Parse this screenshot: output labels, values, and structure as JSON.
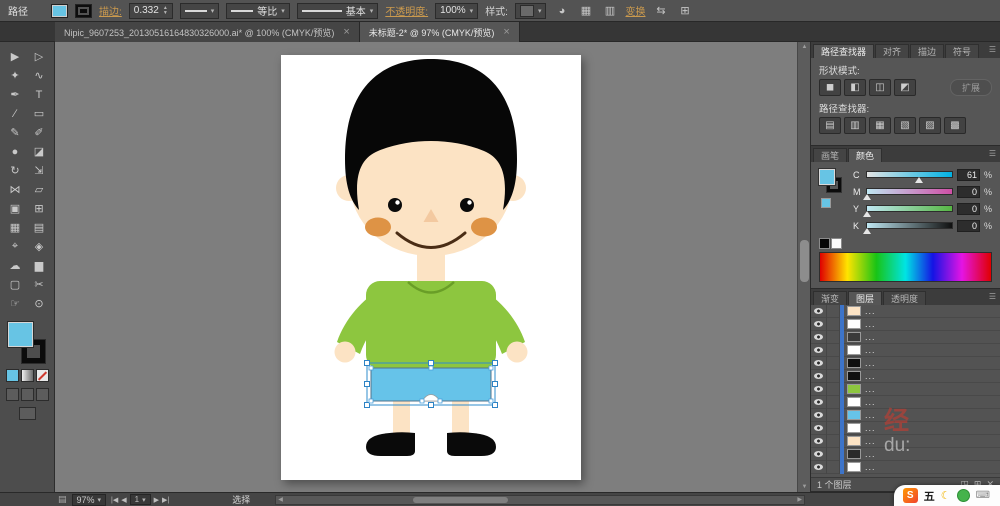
{
  "glyphs": {
    "caret": "▾",
    "up": "▲",
    "down": "▼",
    "left": "◀",
    "right": "▶",
    "first": "|◀",
    "last": "▶|",
    "menu": "☰",
    "grid": "▤"
  },
  "artwork": {
    "skin": "#fce3c4",
    "hair": "#070707",
    "sweater": "#8dc63f",
    "shorts": "#66c3e9",
    "cheek": "#de9345",
    "shoes": "#0a0a0a",
    "selection": "#2f8ccc"
  },
  "options_bar": {
    "context_label": "路径",
    "stroke_label": "描边:",
    "stroke_value": "0.332",
    "profile_value": "等比",
    "brush_value": "基本",
    "opacity_label": "不透明度:",
    "opacity_value": "100%",
    "style_label": "样式:",
    "transform_link": "变换",
    "icons": {
      "recolor": "◕",
      "align_a": "▦",
      "align_b": "▥",
      "arrange_a": "⇆",
      "arrange_b": "⊞"
    }
  },
  "tab_bar": {
    "close_glyph": "×",
    "tabs": [
      {
        "title": "Nipic_9607253_20130516164830326000.ai* @ 100% (CMYK/预览)",
        "active": false
      },
      {
        "title": "未标题-2* @ 97% (CMYK/预览)",
        "active": true
      }
    ]
  },
  "toolbar": {
    "tools": [
      {
        "name": "selection-tool",
        "glyph": "▶"
      },
      {
        "name": "direct-selection-tool",
        "glyph": "▷"
      },
      {
        "name": "magic-wand-tool",
        "glyph": "✦"
      },
      {
        "name": "lasso-tool",
        "glyph": "∿"
      },
      {
        "name": "pen-tool",
        "glyph": "✒"
      },
      {
        "name": "type-tool",
        "glyph": "T"
      },
      {
        "name": "line-segment-tool",
        "glyph": "∕"
      },
      {
        "name": "rectangle-tool",
        "glyph": "▭"
      },
      {
        "name": "paintbrush-tool",
        "glyph": "✎"
      },
      {
        "name": "pencil-tool",
        "glyph": "✐"
      },
      {
        "name": "blob-brush-tool",
        "glyph": "●"
      },
      {
        "name": "eraser-tool",
        "glyph": "◪"
      },
      {
        "name": "rotate-tool",
        "glyph": "↻"
      },
      {
        "name": "scale-tool",
        "glyph": "⇲"
      },
      {
        "name": "width-tool",
        "glyph": "⋈"
      },
      {
        "name": "free-transform-tool",
        "glyph": "▱"
      },
      {
        "name": "shape-builder-tool",
        "glyph": "▣"
      },
      {
        "name": "perspective-grid-tool",
        "glyph": "⊞"
      },
      {
        "name": "mesh-tool",
        "glyph": "▦"
      },
      {
        "name": "gradient-tool",
        "glyph": "▤"
      },
      {
        "name": "eyedropper-tool",
        "glyph": "⌖"
      },
      {
        "name": "blend-tool",
        "glyph": "◈"
      },
      {
        "name": "symbol-sprayer-tool",
        "glyph": "☁"
      },
      {
        "name": "column-graph-tool",
        "glyph": "▆"
      },
      {
        "name": "artboard-tool",
        "glyph": "▢"
      },
      {
        "name": "slice-tool",
        "glyph": "✂"
      },
      {
        "name": "hand-tool",
        "glyph": "☞"
      },
      {
        "name": "zoom-tool",
        "glyph": "⊙"
      }
    ]
  },
  "pathfinder_panel": {
    "tabs": [
      {
        "label": "路径查找器",
        "name": "tab-pathfinder",
        "active": true
      },
      {
        "label": "对齐",
        "name": "tab-align",
        "active": false
      },
      {
        "label": "描边",
        "name": "tab-stroke",
        "active": false
      },
      {
        "label": "符号",
        "name": "tab-symbols",
        "active": false
      }
    ],
    "shape_mode_label": "形状模式:",
    "shape_mode_buttons": [
      {
        "name": "unite-icon",
        "glyph": "◼"
      },
      {
        "name": "minus-front-icon",
        "glyph": "◧"
      },
      {
        "name": "intersect-icon",
        "glyph": "◫"
      },
      {
        "name": "exclude-icon",
        "glyph": "◩"
      }
    ],
    "expand_button": "扩展",
    "pathfinder_label": "路径查找器:",
    "pathfinder_buttons": [
      {
        "name": "divide-icon",
        "glyph": "▤"
      },
      {
        "name": "trim-icon",
        "glyph": "▥"
      },
      {
        "name": "merge-icon",
        "glyph": "▦"
      },
      {
        "name": "crop-icon",
        "glyph": "▧"
      },
      {
        "name": "outline-icon",
        "glyph": "▨"
      },
      {
        "name": "minus-back-icon",
        "glyph": "▩"
      }
    ]
  },
  "color_panel": {
    "tabs": [
      {
        "label": "画笔",
        "name": "tab-brushes",
        "active": false
      },
      {
        "label": "颜色",
        "name": "tab-color",
        "active": true
      }
    ],
    "channels": [
      {
        "label": "C",
        "value": "61",
        "pct": 61
      },
      {
        "label": "M",
        "value": "0",
        "pct": 0
      },
      {
        "label": "Y",
        "value": "0",
        "pct": 0
      },
      {
        "label": "K",
        "value": "0",
        "pct": 0
      }
    ],
    "unit": "%"
  },
  "layers_panel": {
    "tabs": [
      {
        "label": "渐变",
        "name": "tab-gradient",
        "active": false
      },
      {
        "label": "图层",
        "name": "tab-layers",
        "active": true
      },
      {
        "label": "透明度",
        "name": "tab-transparency",
        "active": false
      }
    ],
    "rows": [
      {
        "thumb": "#fce3c4",
        "label": "...",
        "selected": true
      },
      {
        "thumb": "#ffffff",
        "label": "...",
        "selected": true
      },
      {
        "thumb": "#3a3a3a",
        "label": "...",
        "selected": true
      },
      {
        "thumb": "#ffffff",
        "label": "...",
        "selected": true
      },
      {
        "thumb": "#101010",
        "label": "...",
        "selected": true
      },
      {
        "thumb": "#101010",
        "label": "...",
        "selected": true
      },
      {
        "thumb": "#8dc63f",
        "label": "...",
        "selected": true
      },
      {
        "thumb": "#ffffff",
        "label": "...",
        "selected": true
      },
      {
        "thumb": "#66c3e9",
        "label": "...",
        "selected": true
      },
      {
        "thumb": "#ffffff",
        "label": "...",
        "selected": true
      },
      {
        "thumb": "#fce3c4",
        "label": "...",
        "selected": true
      },
      {
        "thumb": "#2a2a2a",
        "label": "...",
        "selected": true
      },
      {
        "thumb": "#ffffff",
        "label": "...",
        "selected": true
      }
    ],
    "footer_label": "1 个图层",
    "footer_icons": [
      {
        "name": "make-mask-icon",
        "glyph": "◳"
      },
      {
        "name": "new-layer-icon",
        "glyph": "⊞"
      },
      {
        "name": "delete-layer-icon",
        "glyph": "✕"
      }
    ]
  },
  "status_bar": {
    "zoom": "97%",
    "artboard_number": "1",
    "tool_status": "选择"
  },
  "ime": {
    "logo_letter": "S",
    "mode_label": "五",
    "moon": "☾",
    "keyboard": "⌨"
  },
  "watermark": {
    "char": "经",
    "text": "du:"
  }
}
